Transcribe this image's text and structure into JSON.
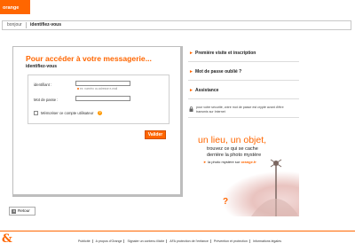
{
  "brand": {
    "logo_text": "orange",
    "accent": "#ff6600"
  },
  "breadcrumb": {
    "home": "bonjour",
    "current": "identifiez-vous"
  },
  "login": {
    "title": "Pour accéder à votre messagerie...",
    "subtitle": "identifiez-vous",
    "identifier_label": "identifiant :",
    "identifier_value": "",
    "identifier_hint": "ex: numéro ou adresse e-mail",
    "password_label": "Mot de passe :",
    "password_value": "",
    "remember_label": "Mémoriser ce compte utilisateur",
    "remember_checked": false,
    "help_icon": "help-icon",
    "submit_label": "Valider"
  },
  "side_links": [
    {
      "label": "Première visite et inscription"
    },
    {
      "label": "Mot de passe oublié ?"
    },
    {
      "label": "Assistance"
    }
  ],
  "security_note": "pour votre sécurité, votre mot de passe est crypté avant d'être transmis sur Internet",
  "promo": {
    "headline": "un lieu, un objet,",
    "line2": "trouvez ce qui se cache",
    "line3": "derrière la photo mystère",
    "cta_prefix": "la photo mystère sur",
    "cta_site": "orange.fr",
    "question_mark": "?"
  },
  "back_button": {
    "label": "Retour"
  },
  "footer": {
    "amp": "&",
    "links": [
      "Publicité",
      "A propos d'Orange",
      "Signaler un contenu illicite",
      "AFA protection de l'enfance",
      "Prévention et protection",
      "Informations légales"
    ]
  }
}
